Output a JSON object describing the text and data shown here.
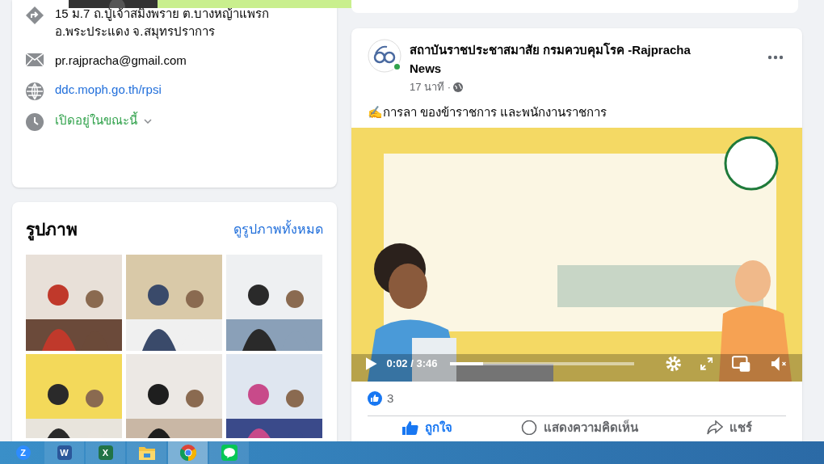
{
  "about": {
    "items": [
      {
        "kind": "address",
        "text": "15 ม.7 ถ.ปู่เจ้าสมิงพราย ต.บางหญ้าแพรก อ.พระประแดง จ.สมุทรปราการ"
      },
      {
        "kind": "email",
        "text": "pr.rajpracha@gmail.com"
      },
      {
        "kind": "website",
        "text": "ddc.moph.go.th/rpsi"
      },
      {
        "kind": "hours",
        "text": "เปิดอยู่ในขณะนี้"
      }
    ]
  },
  "photos": {
    "title": "รูปภาพ",
    "see_all": "ดูรูปภาพทั้งหมด"
  },
  "post": {
    "author": "สถาบันราชประชาสมาสัย กรมควบคุมโรค -Rajpracha News",
    "online": true,
    "time": "17 นาที ·",
    "text": "✍การลา ของข้าราชการ และพนักงานราชการ",
    "video": {
      "time": "0:02 / 3:46",
      "level": 0.18,
      "muted": true
    },
    "reactions": "3",
    "actions": [
      {
        "kind": "like",
        "label": "ถูกใจ"
      },
      {
        "kind": "comment",
        "label": "แสดงความคิดเห็น"
      },
      {
        "kind": "share",
        "label": "แชร์"
      }
    ]
  },
  "taskbar": [
    {
      "kind": "zoom",
      "glyph": "Z",
      "selected": false
    },
    {
      "kind": "word",
      "glyph": "W",
      "selected": false
    },
    {
      "kind": "excel",
      "glyph": "X",
      "selected": false
    },
    {
      "kind": "explorer",
      "selected": false
    },
    {
      "kind": "chrome",
      "selected": true
    },
    {
      "kind": "line",
      "selected": false
    }
  ]
}
